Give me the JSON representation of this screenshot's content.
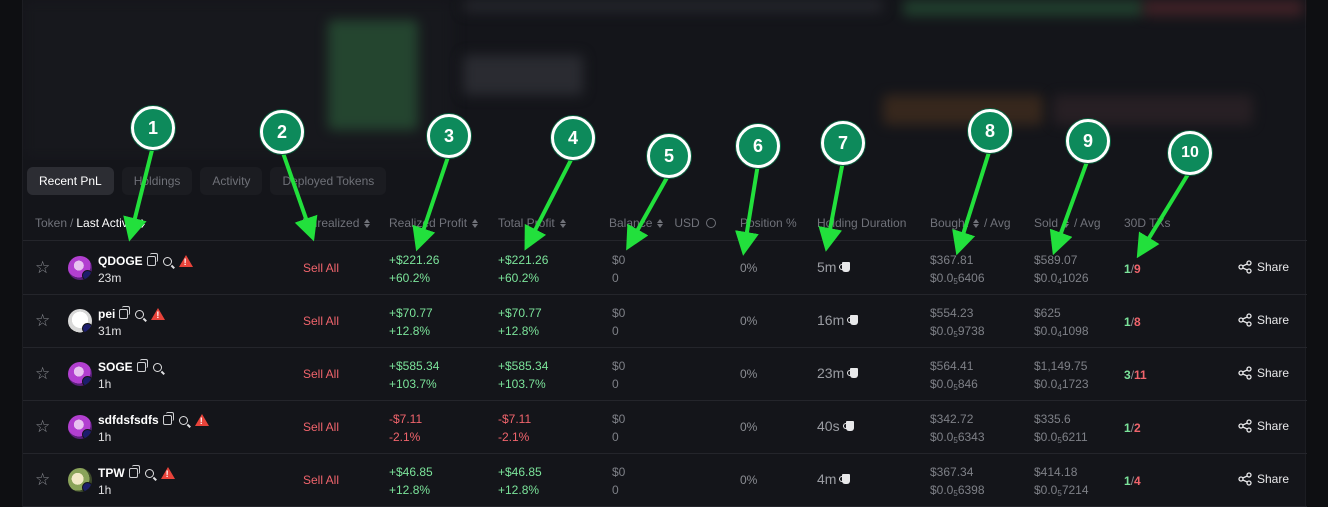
{
  "tabs": [
    "Recent PnL",
    "Holdings",
    "Activity",
    "Deployed Tokens"
  ],
  "headers": {
    "token": "Token",
    "slash": "/",
    "last_active": "Last Active",
    "unrealized": "Unrealized",
    "realized_profit": "Realized Profit",
    "total_profit": "Total Profit",
    "balance": "Balance",
    "usd": "USD",
    "position": "Position %",
    "holding_duration": "Holding Duration",
    "bought": "Bought",
    "bought_avg": "/  Avg",
    "sold": "Sold",
    "sold_avg": "/  Avg",
    "txs": "30D TXs"
  },
  "rows": [
    {
      "name": "QDOGE",
      "age": "23m",
      "sell": "Sell All",
      "rp": "+$221.26",
      "rp_pct": "+60.2%",
      "tp": "+$221.26",
      "tp_pct": "+60.2%",
      "bal": "$0",
      "bal_amt": "0",
      "pos": "0%",
      "hold": "5m",
      "bought": "$367.81",
      "bought_avg_a": "$0.0",
      "bought_avg_sub": "5",
      "bought_avg_b": "6406",
      "sold": "$589.07",
      "sold_avg_a": "$0.0",
      "sold_avg_sub": "4",
      "sold_avg_b": "1026",
      "tx_buy": "1",
      "tx_sell": "9",
      "share": "Share",
      "warn": true,
      "avatar": "dog"
    },
    {
      "name": "pei",
      "age": "31m",
      "sell": "Sell All",
      "rp": "+$70.77",
      "rp_pct": "+12.8%",
      "tp": "+$70.77",
      "tp_pct": "+12.8%",
      "bal": "$0",
      "bal_amt": "0",
      "pos": "0%",
      "hold": "16m",
      "bought": "$554.23",
      "bought_avg_a": "$0.0",
      "bought_avg_sub": "5",
      "bought_avg_b": "9738",
      "sold": "$625",
      "sold_avg_a": "$0.0",
      "sold_avg_sub": "4",
      "sold_avg_b": "1098",
      "tx_buy": "1",
      "tx_sell": "8",
      "share": "Share",
      "warn": true,
      "avatar": "white"
    },
    {
      "name": "SOGE",
      "age": "1h",
      "sell": "Sell All",
      "rp": "+$585.34",
      "rp_pct": "+103.7%",
      "tp": "+$585.34",
      "tp_pct": "+103.7%",
      "bal": "$0",
      "bal_amt": "0",
      "pos": "0%",
      "hold": "23m",
      "bought": "$564.41",
      "bought_avg_a": "$0.0",
      "bought_avg_sub": "5",
      "bought_avg_b": "846",
      "sold": "$1,149.75",
      "sold_avg_a": "$0.0",
      "sold_avg_sub": "4",
      "sold_avg_b": "1723",
      "tx_buy": "3",
      "tx_sell": "11",
      "share": "Share",
      "warn": false,
      "avatar": "dog"
    },
    {
      "name": "sdfdsfsdfs",
      "age": "1h",
      "sell": "Sell All",
      "rp": "-$7.11",
      "rp_pct": "-2.1%",
      "tp": "-$7.11",
      "tp_pct": "-2.1%",
      "bal": "$0",
      "bal_amt": "0",
      "pos": "0%",
      "hold": "40s",
      "bought": "$342.72",
      "bought_avg_a": "$0.0",
      "bought_avg_sub": "5",
      "bought_avg_b": "6343",
      "sold": "$335.6",
      "sold_avg_a": "$0.0",
      "sold_avg_sub": "5",
      "sold_avg_b": "6211",
      "tx_buy": "1",
      "tx_sell": "2",
      "share": "Share",
      "warn": true,
      "avatar": "dog"
    },
    {
      "name": "TPW",
      "age": "1h",
      "sell": "Sell All",
      "rp": "+$46.85",
      "rp_pct": "+12.8%",
      "tp": "+$46.85",
      "tp_pct": "+12.8%",
      "bal": "$0",
      "bal_amt": "0",
      "pos": "0%",
      "hold": "4m",
      "bought": "$367.34",
      "bought_avg_a": "$0.0",
      "bought_avg_sub": "5",
      "bought_avg_b": "6398",
      "sold": "$414.18",
      "sold_avg_a": "$0.0",
      "sold_avg_sub": "5",
      "sold_avg_b": "7214",
      "tx_buy": "1",
      "tx_sell": "4",
      "share": "Share",
      "warn": true,
      "avatar": "pepe"
    }
  ],
  "markers": [
    "1",
    "2",
    "3",
    "4",
    "5",
    "6",
    "7",
    "8",
    "9",
    "10"
  ],
  "colors": {
    "marker": "#0d8a5b",
    "arrow": "#22e03c",
    "profit": "#7be39a",
    "loss": "#f0646c"
  }
}
